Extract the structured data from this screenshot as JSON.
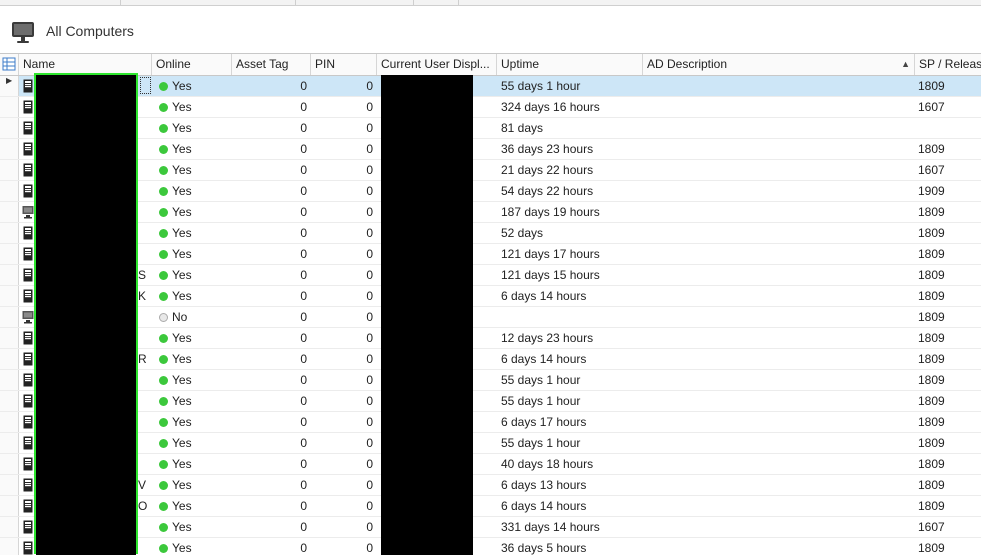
{
  "window": {
    "title": "All Computers"
  },
  "columns": [
    {
      "key": "name",
      "label": "Name"
    },
    {
      "key": "online",
      "label": "Online"
    },
    {
      "key": "asset_tag",
      "label": "Asset Tag"
    },
    {
      "key": "pin",
      "label": "PIN"
    },
    {
      "key": "current_user",
      "label": "Current User Displ..."
    },
    {
      "key": "uptime",
      "label": "Uptime"
    },
    {
      "key": "ad_description",
      "label": "AD Description"
    },
    {
      "key": "sp_release",
      "label": "SP / Release"
    }
  ],
  "sort": {
    "column": "AD Description",
    "direction": "ascending"
  },
  "rows": [
    {
      "name_suffix": "",
      "online": "Yes",
      "online_status": "on",
      "asset_tag": "0",
      "pin": "0",
      "uptime": "55 days 1 hour",
      "sp": "1809",
      "icon": "pc-tower-icon"
    },
    {
      "name_suffix": "",
      "online": "Yes",
      "online_status": "on",
      "asset_tag": "0",
      "pin": "0",
      "uptime": "324 days 16 hours",
      "sp": "1607",
      "icon": "pc-tower-icon"
    },
    {
      "name_suffix": "",
      "online": "Yes",
      "online_status": "on",
      "asset_tag": "0",
      "pin": "0",
      "uptime": "81 days",
      "sp": "",
      "icon": "pc-tower-icon"
    },
    {
      "name_suffix": "",
      "online": "Yes",
      "online_status": "on",
      "asset_tag": "0",
      "pin": "0",
      "uptime": "36 days 23 hours",
      "sp": "1809",
      "icon": "pc-tower-icon"
    },
    {
      "name_suffix": "",
      "online": "Yes",
      "online_status": "on",
      "asset_tag": "0",
      "pin": "0",
      "uptime": "21 days 22 hours",
      "sp": "1607",
      "icon": "pc-tower-icon"
    },
    {
      "name_suffix": "",
      "online": "Yes",
      "online_status": "on",
      "asset_tag": "0",
      "pin": "0",
      "uptime": "54 days 22 hours",
      "sp": "1909",
      "icon": "pc-tower-icon"
    },
    {
      "name_suffix": "",
      "online": "Yes",
      "online_status": "on",
      "asset_tag": "0",
      "pin": "0",
      "uptime": "187 days 19 hours",
      "sp": "1809",
      "icon": "monitor-icon"
    },
    {
      "name_suffix": "",
      "online": "Yes",
      "online_status": "on",
      "asset_tag": "0",
      "pin": "0",
      "uptime": "52 days",
      "sp": "1809",
      "icon": "pc-tower-icon"
    },
    {
      "name_suffix": "",
      "online": "Yes",
      "online_status": "on",
      "asset_tag": "0",
      "pin": "0",
      "uptime": "121 days 17 hours",
      "sp": "1809",
      "icon": "pc-tower-icon"
    },
    {
      "name_suffix": "S",
      "online": "Yes",
      "online_status": "on",
      "asset_tag": "0",
      "pin": "0",
      "uptime": "121 days 15 hours",
      "sp": "1809",
      "icon": "pc-tower-icon"
    },
    {
      "name_suffix": "K",
      "online": "Yes",
      "online_status": "on",
      "asset_tag": "0",
      "pin": "0",
      "uptime": "6 days 14 hours",
      "sp": "1809",
      "icon": "pc-tower-icon"
    },
    {
      "name_suffix": "",
      "online": "No",
      "online_status": "off",
      "asset_tag": "0",
      "pin": "0",
      "uptime": "",
      "sp": "1809",
      "icon": "monitor-icon"
    },
    {
      "name_suffix": "",
      "online": "Yes",
      "online_status": "on",
      "asset_tag": "0",
      "pin": "0",
      "uptime": "12 days 23 hours",
      "sp": "1809",
      "icon": "pc-tower-icon"
    },
    {
      "name_suffix": "R",
      "online": "Yes",
      "online_status": "on",
      "asset_tag": "0",
      "pin": "0",
      "uptime": "6 days 14 hours",
      "sp": "1809",
      "icon": "pc-tower-icon"
    },
    {
      "name_suffix": "",
      "online": "Yes",
      "online_status": "on",
      "asset_tag": "0",
      "pin": "0",
      "uptime": "55 days 1 hour",
      "sp": "1809",
      "icon": "pc-tower-icon"
    },
    {
      "name_suffix": "",
      "online": "Yes",
      "online_status": "on",
      "asset_tag": "0",
      "pin": "0",
      "uptime": "55 days 1 hour",
      "sp": "1809",
      "icon": "pc-tower-icon"
    },
    {
      "name_suffix": "",
      "online": "Yes",
      "online_status": "on",
      "asset_tag": "0",
      "pin": "0",
      "uptime": "6 days 17 hours",
      "sp": "1809",
      "icon": "pc-tower-icon"
    },
    {
      "name_suffix": "",
      "online": "Yes",
      "online_status": "on",
      "asset_tag": "0",
      "pin": "0",
      "uptime": "55 days 1 hour",
      "sp": "1809",
      "icon": "pc-tower-icon"
    },
    {
      "name_suffix": "",
      "online": "Yes",
      "online_status": "on",
      "asset_tag": "0",
      "pin": "0",
      "uptime": "40 days 18 hours",
      "sp": "1809",
      "icon": "pc-tower-icon"
    },
    {
      "name_suffix": "V",
      "online": "Yes",
      "online_status": "on",
      "asset_tag": "0",
      "pin": "0",
      "uptime": "6 days 13 hours",
      "sp": "1809",
      "icon": "pc-tower-icon"
    },
    {
      "name_suffix": "O",
      "online": "Yes",
      "online_status": "on",
      "asset_tag": "0",
      "pin": "0",
      "uptime": "6 days 14 hours",
      "sp": "1809",
      "icon": "pc-tower-icon"
    },
    {
      "name_suffix": "",
      "online": "Yes",
      "online_status": "on",
      "asset_tag": "0",
      "pin": "0",
      "uptime": "331 days 14 hours",
      "sp": "1607",
      "icon": "pc-tower-icon"
    },
    {
      "name_suffix": "",
      "online": "Yes",
      "online_status": "on",
      "asset_tag": "0",
      "pin": "0",
      "uptime": "36 days 5 hours",
      "sp": "1809",
      "icon": "pc-tower-icon"
    }
  ],
  "colors": {
    "online": "#3cc83c",
    "selected_row": "#cde6f7",
    "highlight_outline": "#2ee62e"
  }
}
